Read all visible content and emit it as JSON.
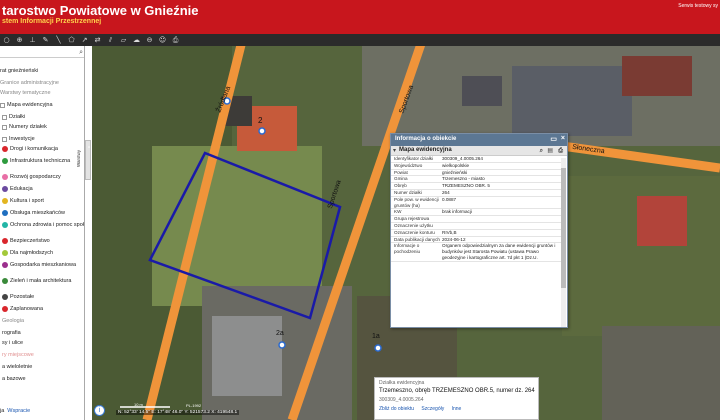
{
  "header": {
    "title": "tarostwo Powiatowe w Gnieźnie",
    "subtitle": "stem Informacji Przestrzennej",
    "test_note": "Serwis testowy sy"
  },
  "toolbar": {
    "icons": [
      "circle-icon",
      "zoom-in-icon",
      "ruler-icon",
      "pencil-icon",
      "line-icon",
      "polygon-icon",
      "arrow-icon",
      "swap-icon",
      "hatch-icon",
      "area-icon",
      "cloud-icon",
      "lock-icon",
      "person-icon",
      "print-icon"
    ]
  },
  "sidebar": {
    "search_icon": "search-icon",
    "layers": [
      {
        "label": "rat gnieźnieński",
        "style": "plain"
      },
      {
        "label": "Granice administracyjne",
        "style": "muted"
      },
      {
        "label": "Warstwy tematyczne",
        "style": "muted"
      },
      {
        "label": "Mapa ewidencyjna",
        "style": "plain"
      },
      {
        "label": "Działki",
        "style": "plain"
      },
      {
        "label": "Numery działek",
        "style": "plain"
      },
      {
        "label": "Inwestycje",
        "style": "plain"
      },
      {
        "label": "Drogi i komunikacja",
        "style": "dot",
        "color": "#d9262c"
      },
      {
        "label": "Infrastruktura techniczna",
        "style": "dot",
        "color": "#2e9b3e"
      },
      {
        "label": "Rozwój gospodarczy",
        "style": "dot",
        "color": "#e86fa6"
      },
      {
        "label": "Edukacja",
        "style": "dot",
        "color": "#6b4aa0"
      },
      {
        "label": "Kultura i sport",
        "style": "dot",
        "color": "#e3b520"
      },
      {
        "label": "Obsługa mieszkańców",
        "style": "dot",
        "color": "#1f6fc0"
      },
      {
        "label": "Ochrona zdrowia i pomoc społeczna",
        "style": "dot",
        "color": "#23b5a6"
      },
      {
        "label": "Bezpieczeństwo",
        "style": "dot",
        "color": "#d9262c"
      },
      {
        "label": "Dla najmłodszych",
        "style": "dot",
        "color": "#a3c93a"
      },
      {
        "label": "Gospodarka mieszkaniowa",
        "style": "dot",
        "color": "#9b2f8d"
      },
      {
        "label": "Zieleń i mała architektura",
        "style": "dot",
        "color": "#3a8a3a"
      },
      {
        "label": "Pozostałe",
        "style": "dot",
        "color": "#444444"
      },
      {
        "label": "Zaplanowana",
        "style": "dot",
        "color": "#d9262c"
      },
      {
        "label": "Geologia",
        "style": "muted"
      },
      {
        "label": "rografia",
        "style": "plain"
      },
      {
        "label": "sy i ulice",
        "style": "plain"
      },
      {
        "label": "ry miejscowe",
        "style": "lightred"
      },
      {
        "label": "a wieloletnie",
        "style": "plain"
      },
      {
        "label": "a bazowe",
        "style": "plain"
      }
    ],
    "footer_left": "ja",
    "footer_link": "Wspracie"
  },
  "side_tab": "Warstwy",
  "map": {
    "street_labels": [
      "Źródlana",
      "Sportowa",
      "Słoneczna"
    ],
    "poi_labels": [
      "2",
      "2a",
      "1a"
    ],
    "zoom_in": "+",
    "zoom_out": "-"
  },
  "info_popup": {
    "title": "Informacja o obiekcie",
    "section_title": "Mapa ewidencyjna",
    "section_icons": [
      "zoom-icon",
      "table-icon",
      "print-icon"
    ],
    "rows": [
      {
        "key": "Identyfikator działki",
        "value": "300309_4.0005.264"
      },
      {
        "key": "Województwo",
        "value": "wielkopolskie"
      },
      {
        "key": "Powiat",
        "value": "gnieźnieński"
      },
      {
        "key": "Gmina",
        "value": "Trzemeszno - miasto"
      },
      {
        "key": "Obręb",
        "value": "TRZEMESZNO OBR. 5"
      },
      {
        "key": "Numer działki",
        "value": "264"
      },
      {
        "key": "Pole pow. w ewidencji gruntów (ha)",
        "value": "0.0887"
      },
      {
        "key": "KW",
        "value": "brak informacji"
      },
      {
        "key": "Grupa rejestrowa",
        "value": ""
      },
      {
        "key": "Oznaczenie użytku",
        "value": ""
      },
      {
        "key": "Oznaczenie konturu",
        "value": "RIVb,B"
      },
      {
        "key": "Data publikacji danych",
        "value": "2024-06-12"
      },
      {
        "key": "Informacje o pochodzeniu",
        "value": "Organem odpowiedzialnym za dane ewidencji gruntów i budynków jest Starosta Powiatu (ustawa Prawo geodezyjne i kartograficzne art. 7d pkt 1 (Dz.U."
      }
    ]
  },
  "parcel_popup": {
    "heading": "Działka ewidencyjna",
    "line": "Trzemeszno, obręb TRZEMESZNO OBR.5, numer dz. 264",
    "id": "300309_4.0005.264",
    "links": [
      "Zbliż do obiektu",
      "Szczegóły",
      "Inne"
    ]
  },
  "status": {
    "info_label": "i",
    "scale_label": "PL-1992",
    "scale_text": "10 m",
    "coords": "N: 52°33' 14.5\" E: 17°48' 46.0\" Y: 521573.2 X: 419548.1"
  }
}
